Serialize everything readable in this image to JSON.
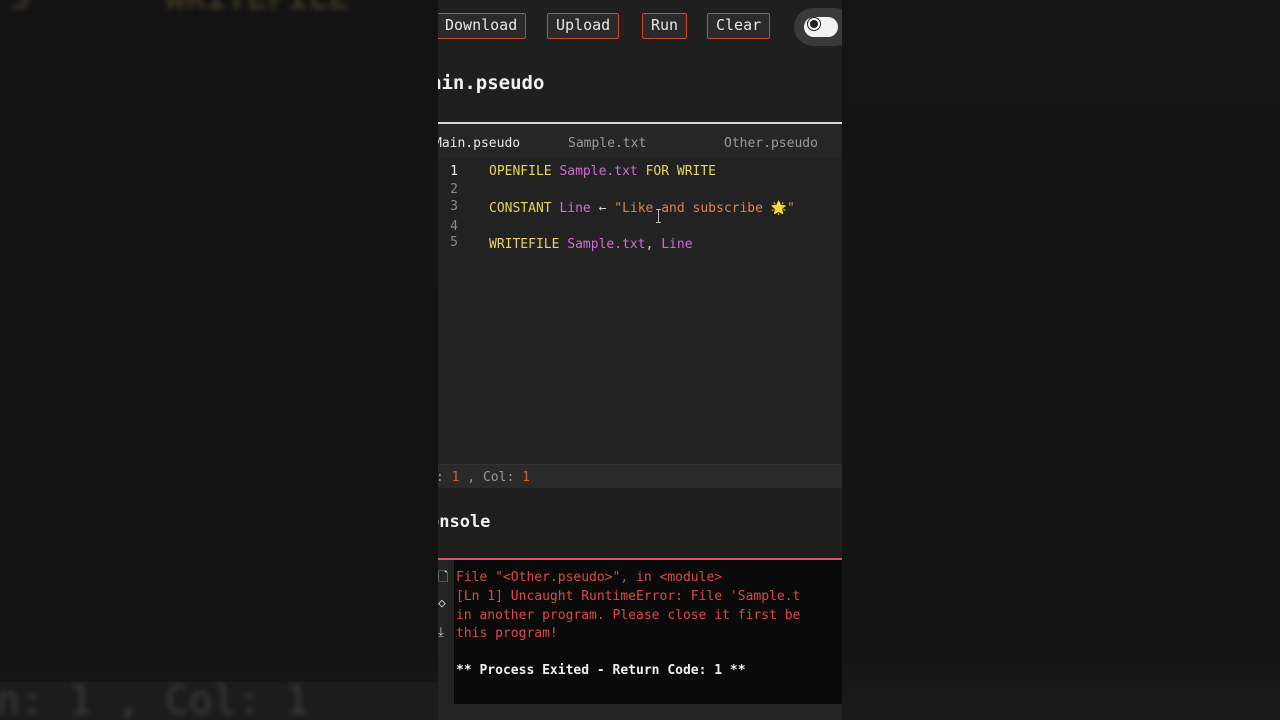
{
  "toolbar": {
    "download": "Download",
    "upload": "Upload",
    "run": "Run",
    "clear": "Clear"
  },
  "file_title": "ain.pseudo",
  "tabs": [
    "Main.pseudo",
    "Sample.txt",
    "Other.pseudo"
  ],
  "code": {
    "line_numbers": [
      "1",
      "2",
      "3",
      "4",
      "5"
    ],
    "l1": {
      "kw1": "OPENFILE",
      "id": "Sample.txt",
      "kw2": "FOR WRITE"
    },
    "l3": {
      "kw": "CONSTANT",
      "id": "Line",
      "op": "←",
      "str": "\"Like and subscribe 🌟\""
    },
    "l5": {
      "kw": "WRITEFILE",
      "id1": "Sample.txt",
      "op": ",",
      "id2": "Line"
    }
  },
  "status": {
    "ln_label": ":",
    "ln_value": "1",
    "col_label": ", Col:",
    "col_value": "1"
  },
  "console_title": "onsole",
  "console": {
    "lines": [
      "File \"<Other.pseudo>\", in <module>",
      "[Ln 1] Uncaught RuntimeError: File 'Sample.t",
      "in another program. Please close it first be",
      "this program!"
    ],
    "exit": "** Process Exited - Return Code: 1 **"
  },
  "background": {
    "top_text": "WRITEFILE",
    "bottom_text": "n: 1 , Col: 1"
  },
  "colors": {
    "accent": "#d2462a",
    "keyword": "#e8d45c",
    "identifier": "#d66ad8",
    "string": "#e08050",
    "error": "#e04848"
  }
}
